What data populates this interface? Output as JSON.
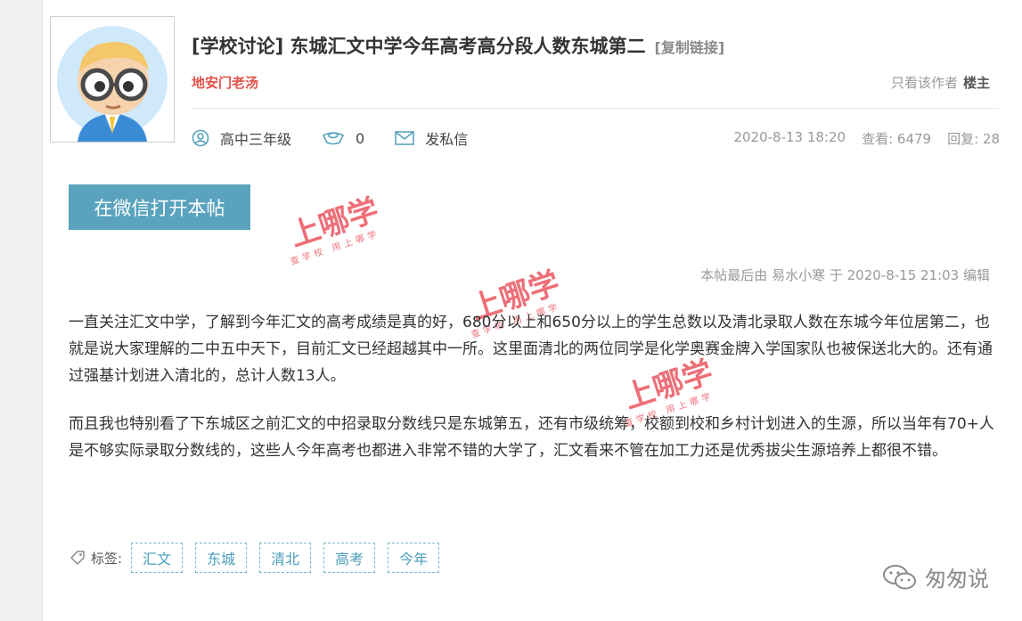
{
  "post": {
    "title": "[学校讨论] 东城汇文中学今年高考高分段人数东城第二",
    "copy_link": "[复制链接]",
    "author": "地安门老汤",
    "only_author_label": "只看该作者",
    "floor_label": "楼主",
    "grade": "高中三年级",
    "coins": "0",
    "message_label": "发私信",
    "datetime": "2020-8-13 18:20",
    "views": "查看: 6479",
    "replies": "回复: 28"
  },
  "wechat_button": "在微信打开本帖",
  "edit_note": "本帖最后由 易水小寒 于 2020-8-15 21:03 编辑",
  "content": {
    "paragraphs": [
      "一直关注汇文中学，了解到今年汇文的高考成绩是真的好，680分以上和650分以上的学生总数以及清北录取人数在东城今年位居第二，也就是说大家理解的二中五中天下，目前汇文已经超越其中一所。这里面清北的两位同学是化学奥赛金牌入学国家队也被保送北大的。还有通过强基计划进入清北的，总计人数13人。",
      "而且我也特别看了下东城区之前汇文的中招录取分数线只是东城第五，还有市级统筹，校额到校和乡村计划进入的生源，所以当年有70+人是不够实际录取分数线的，这些人今年高考也都进入非常不错的大学了，汇文看来不管在加工力还是优秀拔尖生源培养上都很不错。"
    ]
  },
  "tags": {
    "label": "标签:",
    "items": [
      "汇文",
      "东城",
      "清北",
      "高考",
      "今年"
    ]
  },
  "watermark": {
    "logo_text": "上哪学",
    "slogan": "查学校 用上哪学"
  },
  "brand": {
    "name": "匆匆说"
  },
  "colors": {
    "accent": "#5aa3be",
    "author": "#e2524a",
    "tag": "#4a9dbc"
  }
}
